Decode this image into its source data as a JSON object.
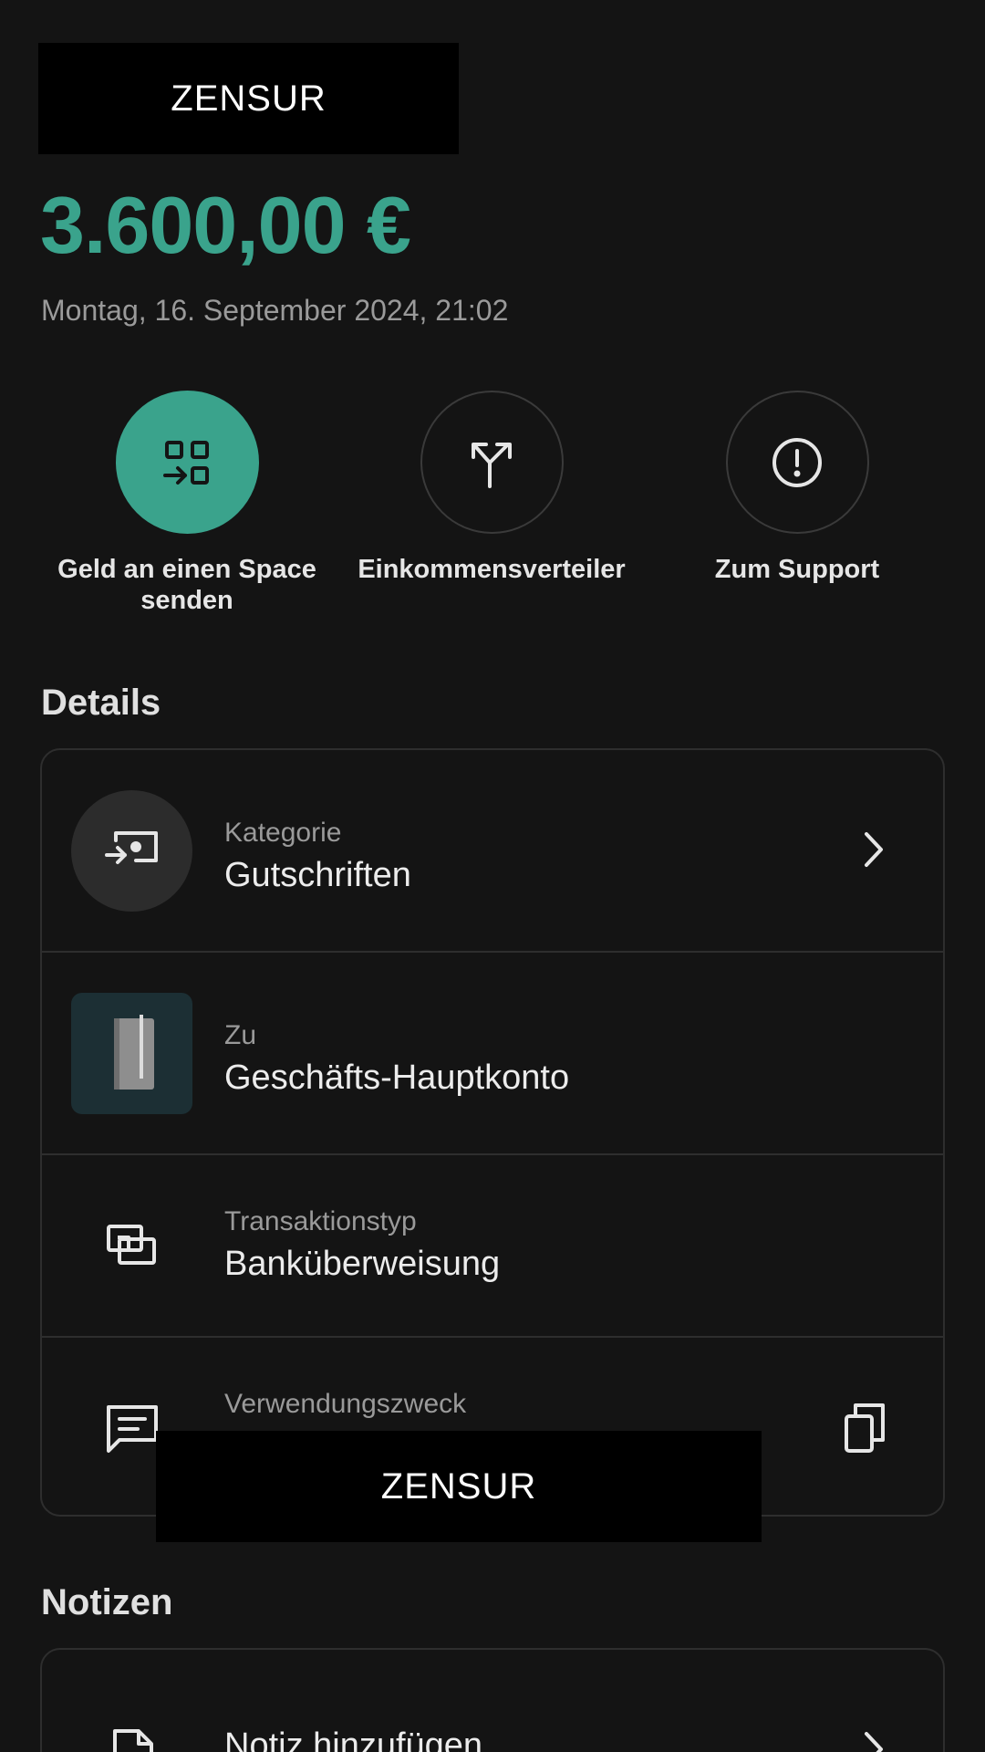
{
  "censored_label": "ZENSUR",
  "transaction": {
    "amount": "3.600,00 €",
    "datetime": "Montag, 16. September 2024, 21:02"
  },
  "actions": [
    {
      "label_line1": "Geld an einen Space",
      "label_line2": "senden",
      "icon": "move-to-space-icon"
    },
    {
      "label_line1": "Einkommensverteiler",
      "label_line2": "",
      "icon": "split-arrow-icon"
    },
    {
      "label_line1": "Zum Support",
      "label_line2": "",
      "icon": "exclamation-circle-icon"
    }
  ],
  "details": {
    "title": "Details",
    "category": {
      "caption": "Kategorie",
      "value": "Gutschriften",
      "icon": "incoming-money-icon"
    },
    "to": {
      "caption": "Zu",
      "value": "Geschäfts-Hauptkonto",
      "icon": "notebook-icon"
    },
    "type": {
      "caption": "Transaktionstyp",
      "value": "Banküberweisung",
      "icon": "bank-transfer-icon"
    },
    "purpose": {
      "caption": "Verwendungszweck",
      "icon": "message-icon"
    }
  },
  "notes": {
    "title": "Notizen",
    "add_label": "Notiz hinzufügen",
    "icon": "document-icon"
  },
  "colors": {
    "accent": "#3aa38c",
    "background": "#141414",
    "border": "#2e2e2e"
  }
}
